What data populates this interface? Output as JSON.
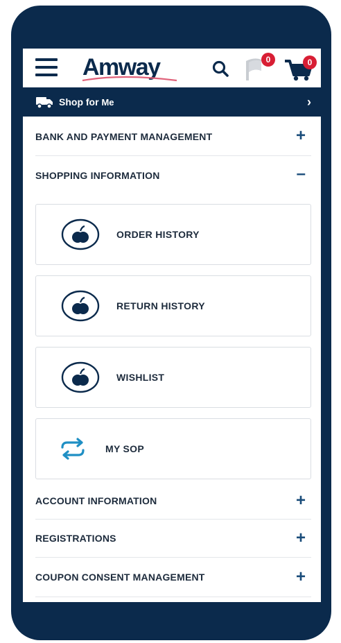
{
  "header": {
    "logo_text": "Amway",
    "wishlist_count": "0",
    "cart_count": "0"
  },
  "shop_bar": {
    "label_prefix": "Shop for",
    "label_suffix": "Me"
  },
  "menu": {
    "bank_payment": "BANK AND PAYMENT MANAGEMENT",
    "shopping_information": "SHOPPING INFORMATION",
    "account_information": "ACCOUNT INFORMATION",
    "registrations": "REGISTRATIONS",
    "coupon_consent": "COUPON CONSENT MANAGEMENT",
    "expand_symbol": "+",
    "collapse_symbol": "–"
  },
  "shopping_items": {
    "order_history": "ORDER HISTORY",
    "return_history": "RETURN HISTORY",
    "wishlist": "WISHLIST",
    "my_sop": "MY SOP"
  },
  "colors": {
    "navy": "#0b2a4c",
    "accent_blue": "#1a4c7a",
    "badge_red": "#d81e34",
    "sop_teal": "#1f8fc4"
  }
}
